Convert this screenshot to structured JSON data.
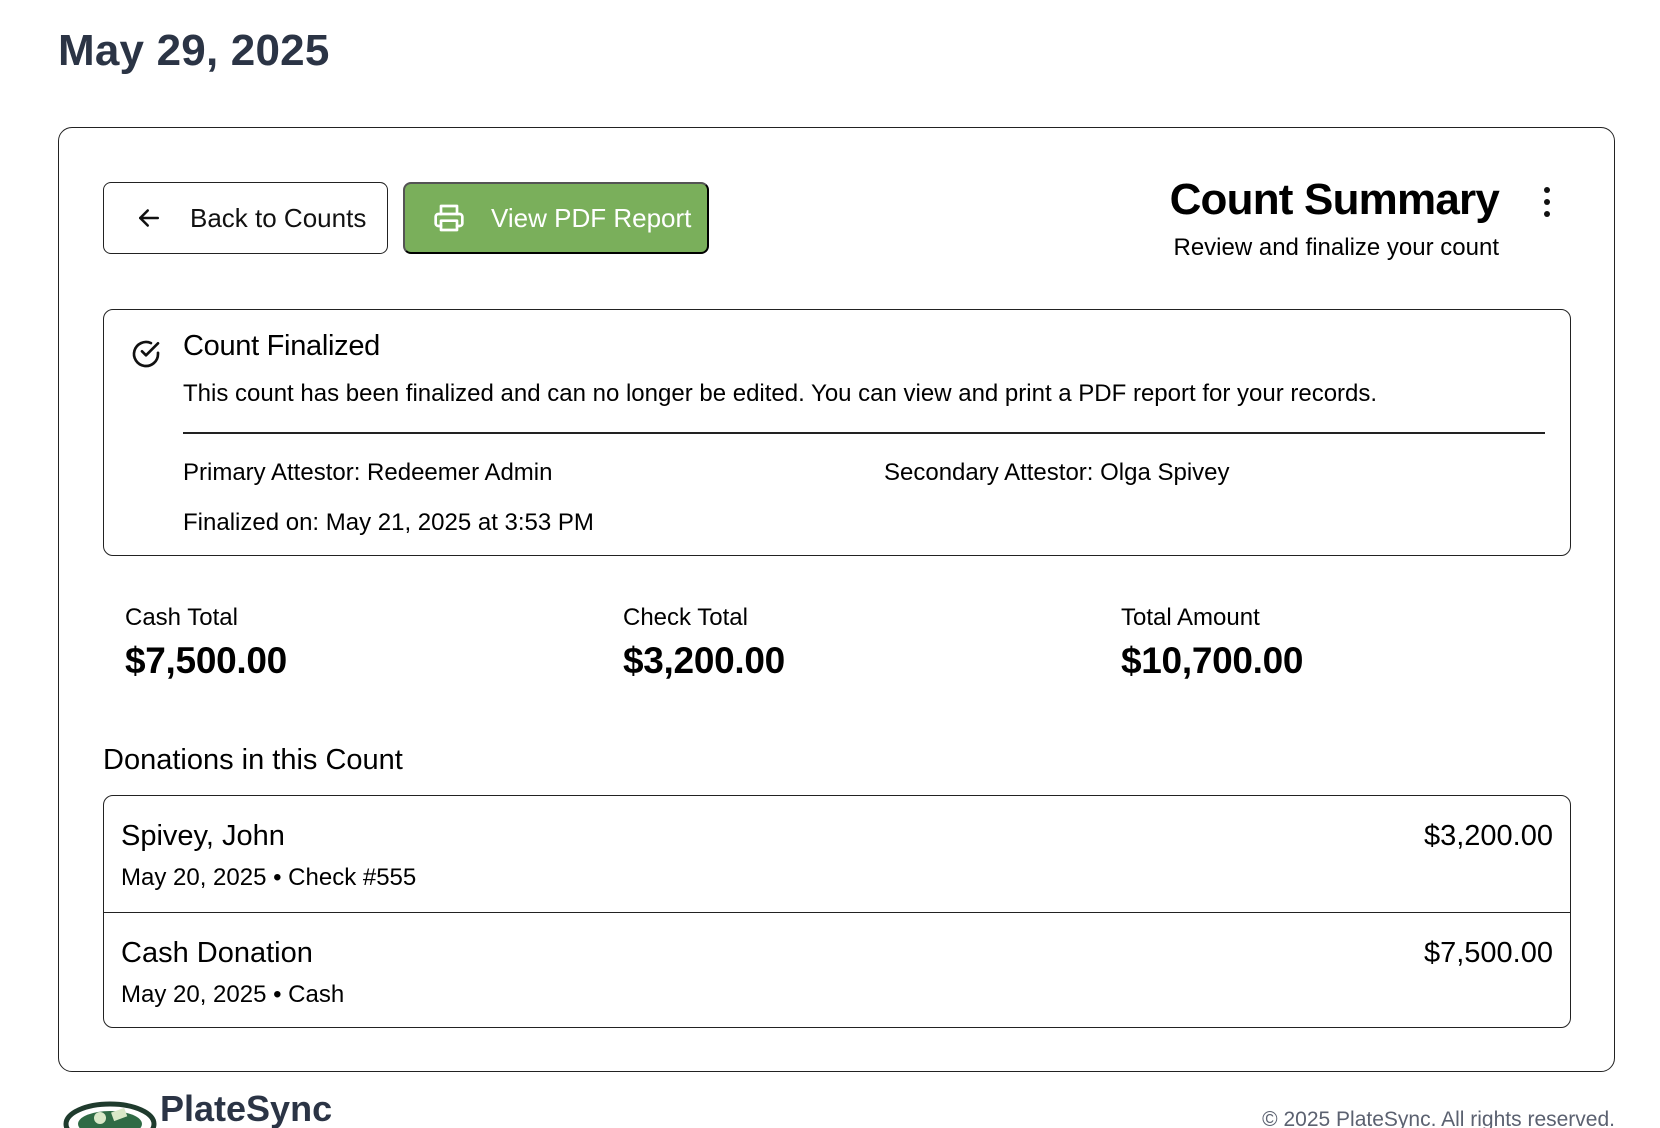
{
  "page": {
    "title": "May 29, 2025"
  },
  "actions": {
    "back_label": "Back to Counts",
    "pdf_label": "View PDF Report"
  },
  "summary": {
    "title": "Count Summary",
    "subtitle": "Review and finalize your count"
  },
  "finalized": {
    "title": "Count Finalized",
    "description": "This count has been finalized and can no longer be edited. You can view and print a PDF report for your records.",
    "primary_attestor": "Primary Attestor: Redeemer Admin",
    "secondary_attestor": "Secondary Attestor: Olga Spivey",
    "finalized_on": "Finalized on: May 21, 2025 at 3:53 PM"
  },
  "totals": [
    {
      "label": "Cash Total",
      "value": "$7,500.00"
    },
    {
      "label": "Check Total",
      "value": "$3,200.00"
    },
    {
      "label": "Total Amount",
      "value": "$10,700.00"
    }
  ],
  "donations": {
    "heading": "Donations in this Count",
    "items": [
      {
        "name": "Spivey, John",
        "meta": "May 20, 2025 • Check #555",
        "amount": "$3,200.00"
      },
      {
        "name": "Cash Donation",
        "meta": "May 20, 2025 • Cash",
        "amount": "$7,500.00"
      }
    ]
  },
  "footer": {
    "brand": "PlateSync",
    "copyright": "© 2025 PlateSync. All rights reserved."
  },
  "colors": {
    "primary_button": "#7aaf5b",
    "heading": "#2b3445",
    "muted_text": "#5b6170",
    "border": "#222222"
  },
  "icons": {
    "back": "arrow-left-icon",
    "pdf": "printer-icon",
    "menu": "more-vertical-icon",
    "finalized": "check-circle-icon",
    "logo": "platesync-logo"
  }
}
